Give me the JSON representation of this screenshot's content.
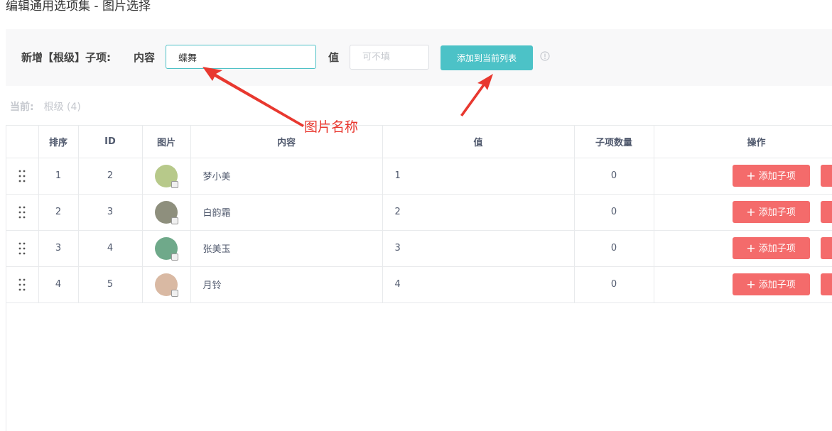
{
  "page": {
    "title": "编辑通用选项集 - 图片选择"
  },
  "form": {
    "label_main": "新增【根级】子项:",
    "label_content": "内容",
    "content_value": "蝶舞",
    "label_value": "值",
    "value_placeholder": "可不填",
    "add_button_label": "添加到当前列表",
    "accent_color": "#4cc2c7"
  },
  "breadcrumb": {
    "label": "当前:",
    "path": "根级 (4)"
  },
  "annotation": {
    "text": "图片名称",
    "color": "#e8382f"
  },
  "table": {
    "headers": {
      "order": "排序",
      "id": "ID",
      "image": "图片",
      "content": "内容",
      "value": "值",
      "children": "子项数量",
      "actions": "操作"
    },
    "rows": [
      {
        "order": "1",
        "id": "2",
        "content": "梦小美",
        "value": "1",
        "children": "0",
        "avatar_color": "#b7c98a"
      },
      {
        "order": "2",
        "id": "3",
        "content": "白韵霜",
        "value": "2",
        "children": "0",
        "avatar_color": "#8e8f7d"
      },
      {
        "order": "3",
        "id": "4",
        "content": "张美玉",
        "value": "3",
        "children": "0",
        "avatar_color": "#6fa98a"
      },
      {
        "order": "4",
        "id": "5",
        "content": "月铃",
        "value": "4",
        "children": "0",
        "avatar_color": "#d9b9a3"
      }
    ],
    "add_child_label": "添加子项",
    "action_color": "#f46b6b"
  }
}
